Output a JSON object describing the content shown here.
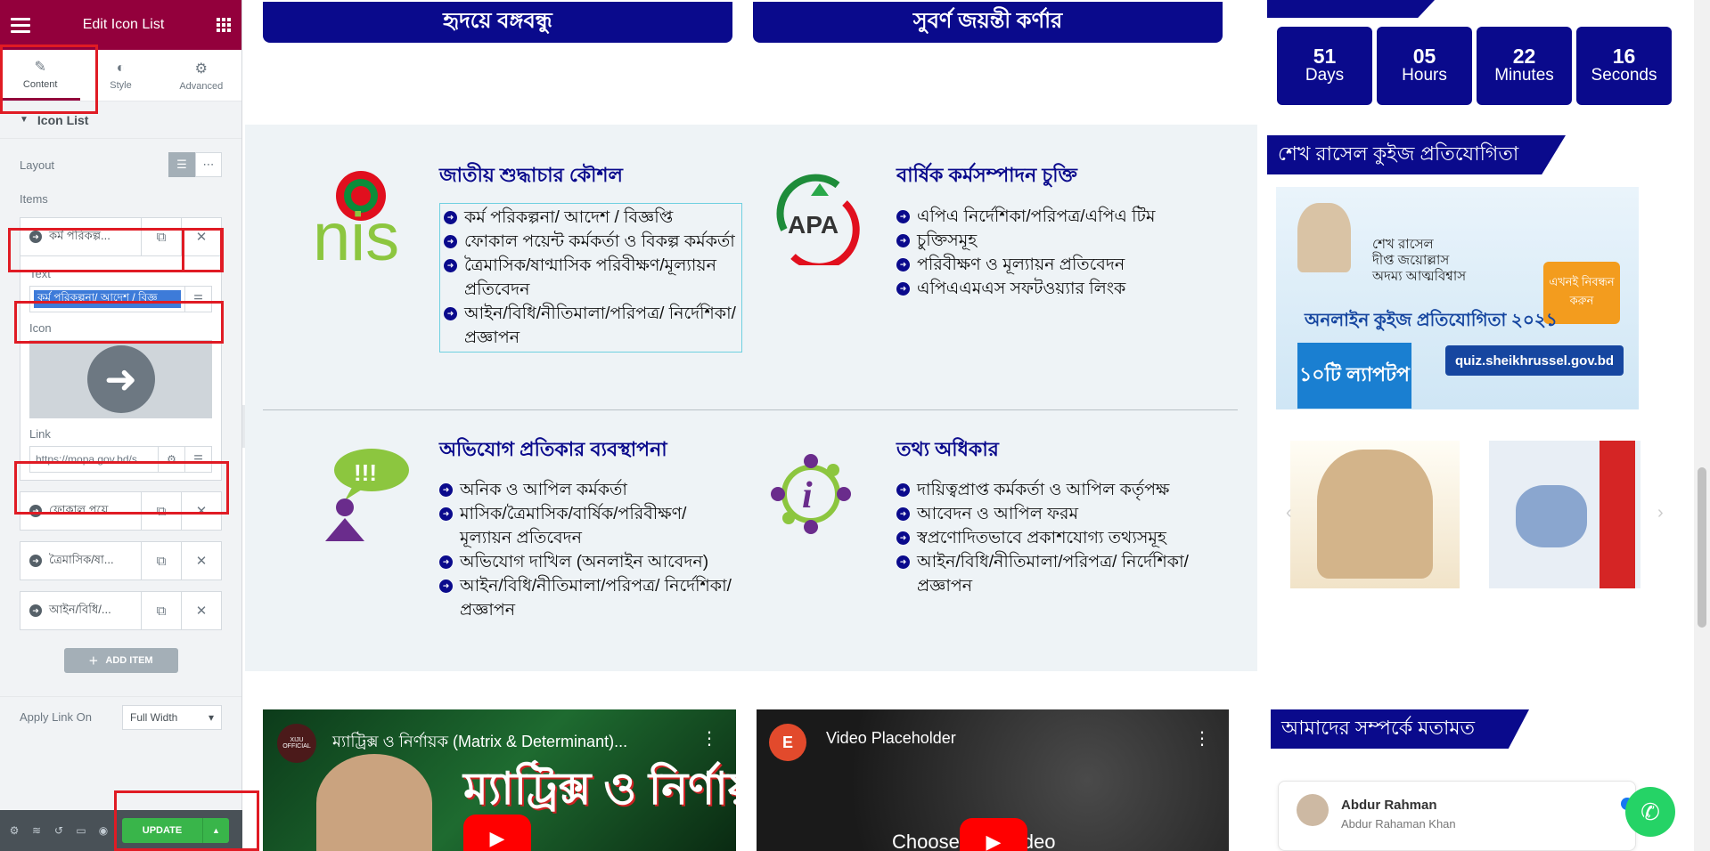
{
  "editor": {
    "title": "Edit Icon List",
    "tabs": [
      {
        "label": "Content",
        "icon": "pencil-icon"
      },
      {
        "label": "Style",
        "icon": "half-circle-icon"
      },
      {
        "label": "Advanced",
        "icon": "gear-icon"
      }
    ],
    "section": "Icon List",
    "layout_label": "Layout",
    "items_label": "Items",
    "items": [
      {
        "label": "কর্ম পরিকল্প..."
      },
      {
        "label": "ফোকাল পয়ে..."
      },
      {
        "label": "ত্রৈমাসিক/ষা..."
      },
      {
        "label": "আইন/বিধি/..."
      }
    ],
    "text_label": "Text",
    "text_value": "কর্ম পরিকল্পনা/ আদেশ / বিজ্ঞ",
    "icon_label": "Icon",
    "link_label": "Link",
    "link_value": "https://mopa.gov.bd/s",
    "add_item": "ADD ITEM",
    "apply_link_label": "Apply Link On",
    "apply_link_value": "Full Width",
    "update": "UPDATE"
  },
  "preview": {
    "top_buttons": [
      "হৃদয়ে বঙ্গবন্ধু",
      "সুবর্ণ জয়ন্তী কর্ণার"
    ],
    "blocks": [
      {
        "title": "জাতীয় শুদ্ধাচার কৌশল",
        "logo_text": "nis",
        "items": [
          "কর্ম পরিকল্পনা/ আদেশ / বিজ্ঞপ্তি",
          "ফোকাল পয়েন্ট কর্মকর্তা ও বিকল্প কর্মকর্তা",
          "ত্রৈমাসিক/ষাণ্মাসিক পরিবীক্ষণ/মূল্যায়ন প্রতিবেদন",
          "আইন/বিধি/নীতিমালা/পরিপত্র/ নির্দেশিকা/প্রজ্ঞাপন"
        ]
      },
      {
        "title": "বার্ষিক কর্মসম্পাদন চুক্তি",
        "logo_text": "APA",
        "items": [
          "এপিএ নির্দেশিকা/পরিপত্র/এপিএ টিম",
          "চুক্তিসমূহ",
          "পরিবীক্ষণ ও মূল্যায়ন প্রতিবেদন",
          "এপিএএমএস সফটওয়্যার লিংক"
        ]
      },
      {
        "title": "অভিযোগ প্রতিকার ব্যবস্থাপনা",
        "logo_text": "!!!",
        "items": [
          "অনিক ও আপিল কর্মকর্তা",
          "মাসিক/ত্রৈমাসিক/বার্ষিক/পরিবীক্ষণ/ মূল্যায়ন প্রতিবেদন",
          "অভিযোগ দাখিল (অনলাইন আবেদন)",
          "আইন/বিধি/নীতিমালা/পরিপত্র/ নির্দেশিকা/প্রজ্ঞাপন"
        ]
      },
      {
        "title": "তথ্য অধিকার",
        "logo_text": "i",
        "items": [
          "দায়িত্বপ্রাপ্ত কর্মকর্তা ও আপিল কর্তৃপক্ষ",
          "আবেদন ও আপিল ফরম",
          "স্বপ্রণোদিতভাবে প্রকাশযোগ্য তথ্যসমূহ",
          "আইন/বিধি/নীতিমালা/পরিপত্র/ নির্দেশিকা/প্রজ্ঞাপন"
        ]
      }
    ],
    "videos": [
      {
        "title": "ম্যাট্রিক্স ও নির্ণায়ক (Matrix & Determinant)...",
        "overlay": "ম্যাট্রিক্স ও নির্ণায়ক",
        "badge": "XIJU OFFICIAL"
      },
      {
        "title": "Video Placeholder",
        "overlay": "Choose your video"
      }
    ]
  },
  "sidebar": {
    "countdown": [
      {
        "num": "51",
        "unit": "Days"
      },
      {
        "num": "05",
        "unit": "Hours"
      },
      {
        "num": "22",
        "unit": "Minutes"
      },
      {
        "num": "16",
        "unit": "Seconds"
      }
    ],
    "quiz_heading": "শেখ রাসেল কুইজ প্রতিযোগিতা",
    "quiz_banner": {
      "line1": "শেখ রাসেল",
      "line2": "দীপ্ত জয়োল্লাস",
      "line3": "অদম্য আত্মবিশ্বাস",
      "contest": "অনলাইন কুইজ প্রতিযোগিতা ২০২১",
      "prize": "১০টি ল্যাপটপ",
      "url": "quiz.sheikhrussel.gov.bd",
      "cta": "এখনই নিবন্ধন করুন"
    },
    "feedback_heading": "আমাদের সম্পর্কে মতামত",
    "testimonial": {
      "name": "Abdur Rahman",
      "sub": "Abdur Rahaman Khan"
    }
  }
}
